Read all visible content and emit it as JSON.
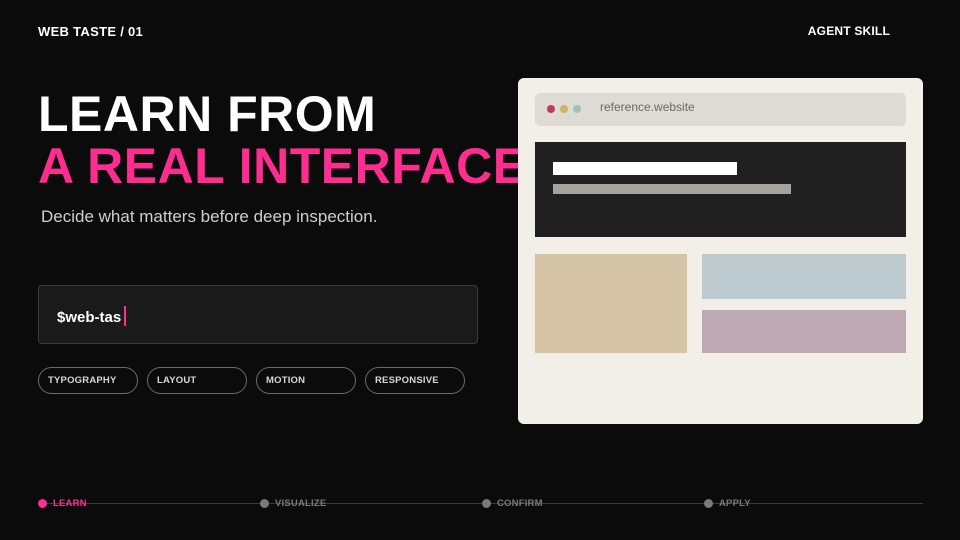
{
  "header": {
    "section_label": "WEB TASTE / 01",
    "badge": "AGENT SKILL"
  },
  "hero": {
    "line1": "LEARN FROM",
    "line2": "A REAL INTERFACE"
  },
  "subtitle": "Decide what matters before deep inspection.",
  "command": {
    "value": "$web-tas"
  },
  "chips": [
    "TYPOGRAPHY",
    "LAYOUT",
    "MOTION",
    "RESPONSIVE"
  ],
  "mockup": {
    "url": "reference.website"
  },
  "timeline": {
    "steps": [
      {
        "label": "LEARN",
        "active": true
      },
      {
        "label": "VISUALIZE",
        "active": false
      },
      {
        "label": "CONFIRM",
        "active": false
      },
      {
        "label": "APPLY",
        "active": false
      }
    ]
  },
  "colors": {
    "accent": "#ff2d8f",
    "background": "#0b0b0b",
    "panel": "#f2efe9"
  }
}
